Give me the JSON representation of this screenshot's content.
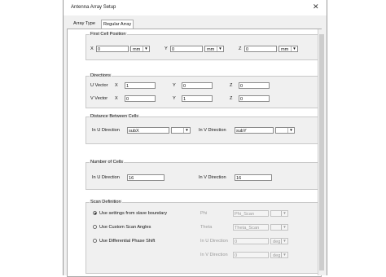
{
  "window": {
    "title": "Antenna Array Setup",
    "close_glyph": "✕"
  },
  "tabs": [
    {
      "label": "Array Type"
    },
    {
      "label": "Regular Array"
    }
  ],
  "first_cell": {
    "legend": "First Cell Position",
    "x_label": "X",
    "x_value": "0",
    "x_unit": "mm",
    "y_label": "Y",
    "y_value": "0",
    "y_unit": "mm",
    "z_label": "Z",
    "z_value": "0",
    "z_unit": "mm"
  },
  "directions": {
    "legend": "Directions",
    "u_label": "U Vector",
    "v_label": "V Vector",
    "x_label": "X",
    "y_label": "Y",
    "z_label": "Z",
    "u": {
      "x": "1",
      "y": "0",
      "z": "0"
    },
    "v": {
      "x": "0",
      "y": "1",
      "z": "0"
    }
  },
  "distance": {
    "legend": "Distance Between Cells",
    "u_label": "In U Direction",
    "u_value": "subX",
    "v_label": "In V Direction",
    "v_value": "subY"
  },
  "num_cells": {
    "legend": "Number of Cells",
    "u_label": "In U Direction",
    "u_value": "16",
    "v_label": "In V Direction",
    "v_value": "16"
  },
  "scan": {
    "legend": "Scan Definition",
    "options": [
      {
        "label": "Use settings from slave boundary",
        "selected": true
      },
      {
        "label": "Use Custom Scan Angles",
        "selected": false
      },
      {
        "label": "Use Differential Phase Shift",
        "selected": false
      }
    ],
    "phi_label": "Phi",
    "phi_value": "Phi_Scan",
    "theta_label": "Theta",
    "theta_value": "Theta_Scan",
    "u_dir_label": "In U Direction",
    "u_dir_value": "0",
    "u_dir_unit": "deg",
    "v_dir_label": "In V Direction",
    "v_dir_value": "0",
    "v_dir_unit": "deg"
  }
}
